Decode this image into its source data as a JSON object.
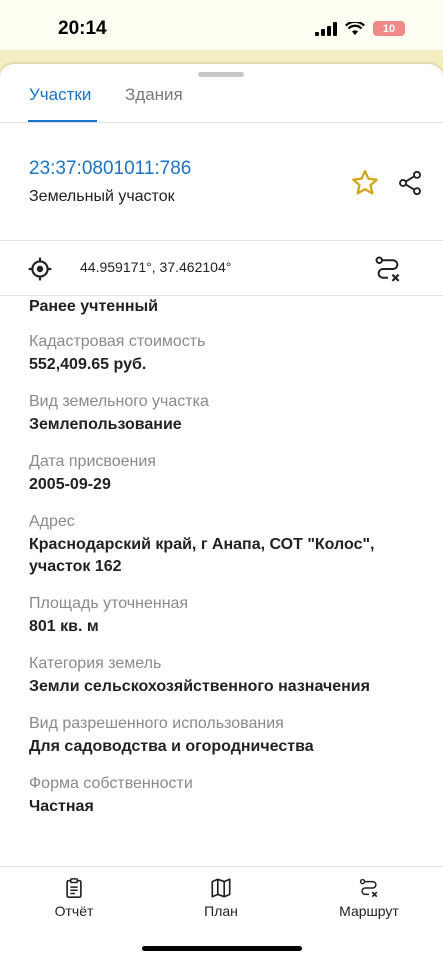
{
  "status_bar": {
    "time": "20:14",
    "battery": "10"
  },
  "tabs": [
    {
      "label": "Участки",
      "active": true
    },
    {
      "label": "Здания",
      "active": false
    }
  ],
  "parcel": {
    "cadastral_number": "23:37:0801011:786",
    "type": "Земельный участок"
  },
  "coordinates": "44.959171°, 37.462104°",
  "first_value": "Ранее учтенный",
  "fields": [
    {
      "label": "Кадастровая стоимость",
      "value": "552,409.65 руб."
    },
    {
      "label": "Вид земельного участка",
      "value": "Землепользование"
    },
    {
      "label": "Дата присвоения",
      "value": "2005-09-29"
    },
    {
      "label": "Адрес",
      "value": "Краснодарский край, г Анапа,  СОТ \"Колос\",  участок 162"
    },
    {
      "label": "Площадь уточненная",
      "value": "801 кв. м"
    },
    {
      "label": "Категория земель",
      "value": "Земли сельскохозяйственного назначения"
    },
    {
      "label": "Вид разрешенного использования",
      "value": "Для садоводства и огородничества"
    },
    {
      "label": "Форма собственности",
      "value": "Частная"
    }
  ],
  "bottom_nav": {
    "report": "Отчёт",
    "map": "План",
    "route": "Маршрут"
  },
  "colors": {
    "accent": "#1a73c8",
    "star": "#d4a514"
  }
}
